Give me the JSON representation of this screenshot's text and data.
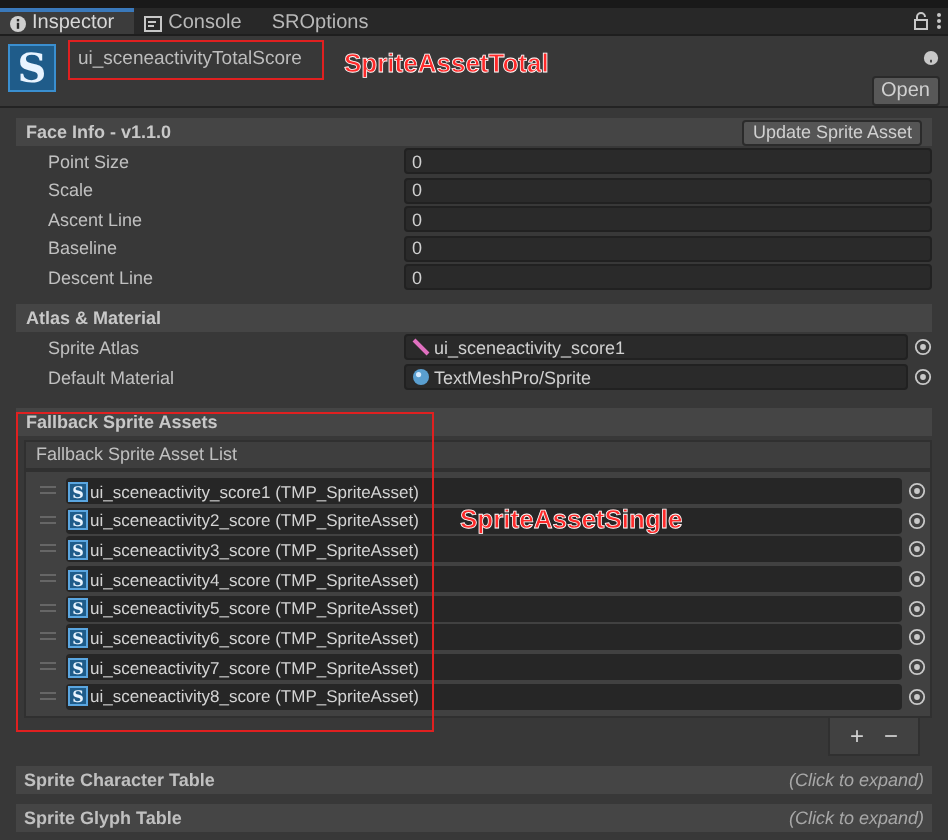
{
  "tabs": [
    {
      "label": "Inspector",
      "kind": "info",
      "selected": true
    },
    {
      "label": "Console",
      "kind": "console",
      "selected": false
    },
    {
      "label": "SROptions",
      "kind": "plain",
      "selected": false
    }
  ],
  "header": {
    "icon_letter": "S",
    "asset_name": "ui_sceneactivityTotalScore",
    "open_button": "Open",
    "annotation": "SpriteAssetTotal"
  },
  "face_info": {
    "title": "Face Info - v1.1.0",
    "button": "Update Sprite Asset",
    "fields": [
      {
        "label": "Point Size",
        "value": "0"
      },
      {
        "label": "Scale",
        "value": "0"
      },
      {
        "label": "Ascent Line",
        "value": "0"
      },
      {
        "label": "Baseline",
        "value": "0"
      },
      {
        "label": "Descent Line",
        "value": "0"
      }
    ]
  },
  "atlas_material": {
    "title": "Atlas & Material",
    "fields": [
      {
        "label": "Sprite Atlas",
        "value": "ui_sceneactivity_score1",
        "kind": "texture"
      },
      {
        "label": "Default Material",
        "value": "TextMeshPro/Sprite",
        "kind": "material"
      }
    ]
  },
  "fallback": {
    "title": "Fallback Sprite Assets",
    "list_title": "Fallback Sprite Asset List",
    "annotation": "SpriteAssetSingle",
    "items": [
      {
        "icon_letter": "S",
        "label": "ui_sceneactivity_score1 (TMP_SpriteAsset)"
      },
      {
        "icon_letter": "S",
        "label": "ui_sceneactivity2_score (TMP_SpriteAsset)"
      },
      {
        "icon_letter": "S",
        "label": "ui_sceneactivity3_score (TMP_SpriteAsset)"
      },
      {
        "icon_letter": "S",
        "label": "ui_sceneactivity4_score (TMP_SpriteAsset)"
      },
      {
        "icon_letter": "S",
        "label": "ui_sceneactivity5_score (TMP_SpriteAsset)"
      },
      {
        "icon_letter": "S",
        "label": "ui_sceneactivity6_score (TMP_SpriteAsset)"
      },
      {
        "icon_letter": "S",
        "label": "ui_sceneactivity7_score (TMP_SpriteAsset)"
      },
      {
        "icon_letter": "S",
        "label": "ui_sceneactivity8_score (TMP_SpriteAsset)"
      }
    ],
    "add": "+",
    "remove": "−"
  },
  "collapsed_sections": [
    {
      "title": "Sprite Character Table",
      "hint": "(Click to expand)"
    },
    {
      "title": "Sprite Glyph Table",
      "hint": "(Click to expand)"
    }
  ]
}
